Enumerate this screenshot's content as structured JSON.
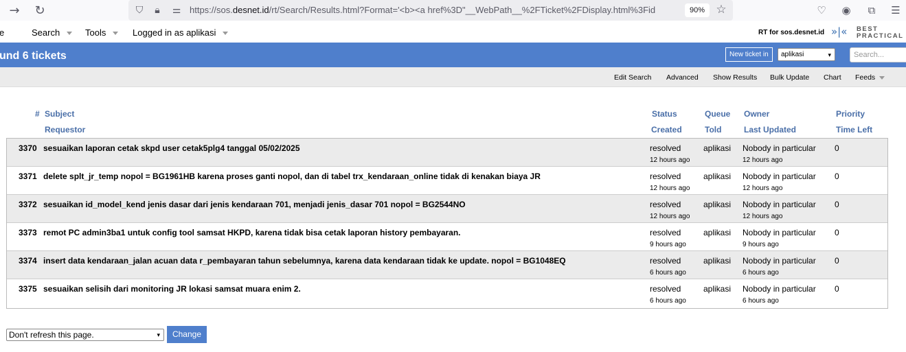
{
  "browser": {
    "url_prefix": "https://sos.",
    "url_host": "desnet.id",
    "url_rest": "/rt/Search/Results.html?Format='<b><a href%3D\"__WebPath__%2FTicket%2FDisplay.html%3Fid",
    "zoom": "90%",
    "icons": [
      "back-arrow-icon",
      "reload-icon",
      "shield-icon",
      "lock-icon",
      "permissions-icon",
      "bookmark-star-icon",
      "pocket-icon",
      "account-icon",
      "extensions-icon",
      "hamburger-menu-icon"
    ]
  },
  "topmenu": {
    "items": [
      "e",
      "Search",
      "Tools",
      "Logged in as aplikasi"
    ],
    "rt_for": "RT for sos.desnet.id",
    "logo_line1": "BEST",
    "logo_line2": "PRACTICAL"
  },
  "header": {
    "title": "und 6 tickets",
    "new_ticket_label": "New ticket in",
    "queue_selected": "aplikasi",
    "search_placeholder": "Search..."
  },
  "pagemenu": {
    "items": [
      "Edit Search",
      "Advanced",
      "Show Results",
      "Bulk Update",
      "Chart",
      "Feeds"
    ]
  },
  "table": {
    "headers": {
      "id": "#",
      "subject": "Subject",
      "requestor": "Requestor",
      "status": "Status",
      "created": "Created",
      "queue": "Queue",
      "told": "Told",
      "owner": "Owner",
      "last_updated": "Last Updated",
      "priority": "Priority",
      "time_left": "Time Left"
    },
    "rows": [
      {
        "id": "3370",
        "subject": "sesuaikan laporan cetak skpd user cetak5plg4 tanggal 05/02/2025",
        "status": "resolved",
        "queue": "aplikasi",
        "owner": "Nobody in particular",
        "priority": "0",
        "created": "12 hours ago",
        "last_updated": "12 hours ago"
      },
      {
        "id": "3371",
        "subject": "delete splt_jr_temp nopol = BG1961HB karena proses ganti nopol, dan di tabel trx_kendaraan_online tidak di kenakan biaya JR",
        "status": "resolved",
        "queue": "aplikasi",
        "owner": "Nobody in particular",
        "priority": "0",
        "created": "12 hours ago",
        "last_updated": "12 hours ago"
      },
      {
        "id": "3372",
        "subject": "sesuaikan id_model_kend jenis dasar dari jenis kendaraan 701, menjadi jenis_dasar 701 nopol = BG2544NO",
        "status": "resolved",
        "queue": "aplikasi",
        "owner": "Nobody in particular",
        "priority": "0",
        "created": "12 hours ago",
        "last_updated": "12 hours ago"
      },
      {
        "id": "3373",
        "subject": "remot PC admin3ba1 untuk config tool samsat HKPD, karena tidak bisa cetak laporan history pembayaran.",
        "status": "resolved",
        "queue": "aplikasi",
        "owner": "Nobody in particular",
        "priority": "0",
        "created": "9 hours ago",
        "last_updated": "9 hours ago"
      },
      {
        "id": "3374",
        "subject": "insert data kendaraan_jalan acuan data r_pembayaran tahun sebelumnya, karena data kendaraan tidak ke update. nopol = BG1048EQ",
        "status": "resolved",
        "queue": "aplikasi",
        "owner": "Nobody in particular",
        "priority": "0",
        "created": "6 hours ago",
        "last_updated": "6 hours ago"
      },
      {
        "id": "3375",
        "subject": "sesuaikan selisih dari monitoring JR lokasi samsat muara enim 2.",
        "status": "resolved",
        "queue": "aplikasi",
        "owner": "Nobody in particular",
        "priority": "0",
        "created": "6 hours ago",
        "last_updated": "6 hours ago"
      }
    ]
  },
  "refresh": {
    "selected": "Don't refresh this page.",
    "button_label": "Change"
  },
  "colors": {
    "header_blue": "#4f7fcc",
    "column_header": "#4a6fa8",
    "row_alt": "#ebebeb"
  }
}
